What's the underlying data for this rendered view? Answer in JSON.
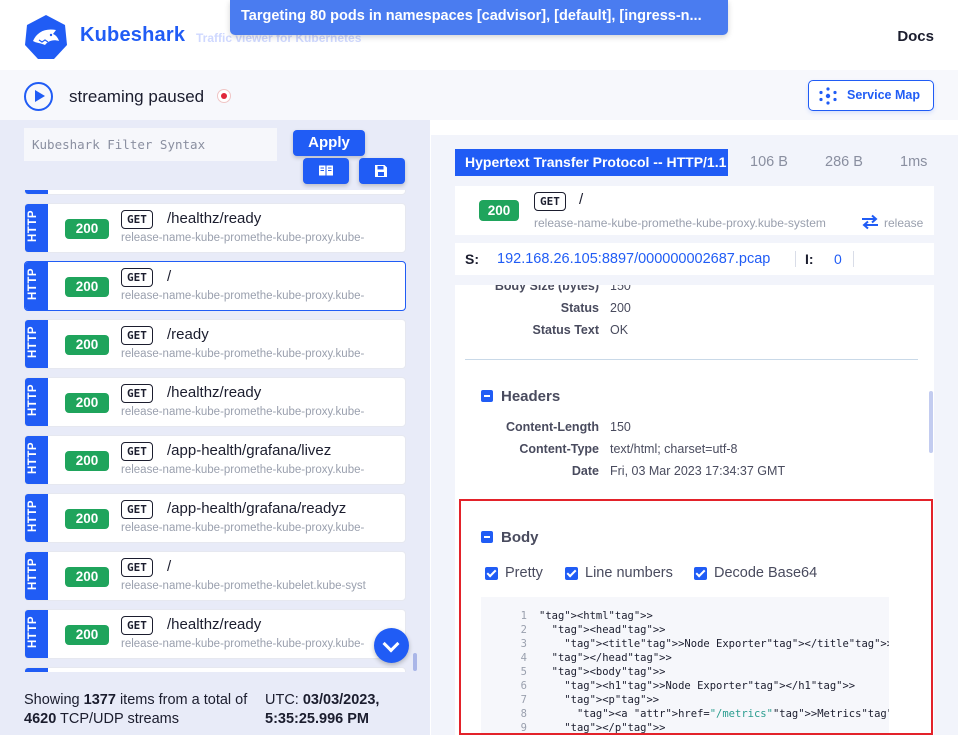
{
  "header": {
    "brand": "Kubeshark",
    "tagline": "Traffic viewer for Kubernetes",
    "docs_label": "Docs",
    "toast": "Targeting 80 pods in namespaces [cadvisor], [default], [ingress-n...",
    "logo_icon": "kubeshark-shark-logo-icon"
  },
  "statusbar": {
    "stream_status": "streaming paused",
    "service_map_label": "Service Map"
  },
  "left_panel": {
    "filter_placeholder": "Kubeshark Filter Syntax",
    "apply_label": "Apply",
    "rows": [
      {
        "protocol": "HTTP",
        "status": "200",
        "method": "GET",
        "path": "/healthz/ready",
        "source": "release-name-kube-promethe-kube-proxy.kube-"
      },
      {
        "protocol": "HTTP",
        "status": "200",
        "method": "GET",
        "path": "/",
        "source": "release-name-kube-promethe-kube-proxy.kube-"
      },
      {
        "protocol": "HTTP",
        "status": "200",
        "method": "GET",
        "path": "/ready",
        "source": "release-name-kube-promethe-kube-proxy.kube-"
      },
      {
        "protocol": "HTTP",
        "status": "200",
        "method": "GET",
        "path": "/healthz/ready",
        "source": "release-name-kube-promethe-kube-proxy.kube-"
      },
      {
        "protocol": "HTTP",
        "status": "200",
        "method": "GET",
        "path": "/app-health/grafana/livez",
        "source": "release-name-kube-promethe-kube-proxy.kube-"
      },
      {
        "protocol": "HTTP",
        "status": "200",
        "method": "GET",
        "path": "/app-health/grafana/readyz",
        "source": "release-name-kube-promethe-kube-proxy.kube-"
      },
      {
        "protocol": "HTTP",
        "status": "200",
        "method": "GET",
        "path": "/",
        "source": "release-name-kube-promethe-kubelet.kube-syst"
      },
      {
        "protocol": "HTTP",
        "status": "200",
        "method": "GET",
        "path": "/healthz/ready",
        "source": "release-name-kube-promethe-kube-proxy.kube-"
      }
    ],
    "footer": {
      "showing_prefix": "Showing ",
      "showing_count": "1377",
      "showing_mid": " items from a total of ",
      "total_count": "4620",
      "showing_suffix": " TCP/UDP streams",
      "utc_prefix": "UTC: ",
      "utc_value": "03/03/2023, 5:35:25.996 PM"
    }
  },
  "right_panel": {
    "protocol_banner": "Hypertext Transfer Protocol -- HTTP/1.1",
    "request_size": "106 B",
    "response_size": "286 B",
    "elapsed": "1ms",
    "entry": {
      "status": "200",
      "method": "GET",
      "path": "/",
      "source": "release-name-kube-promethe-kube-proxy.kube-system",
      "destination": "release"
    },
    "pcap": {
      "s_label": "S:",
      "file": "192.168.26.105:8897/000000002687.pcap",
      "i_label": "I:",
      "i_value": "0"
    },
    "response_fields": [
      {
        "key": "Body Size (bytes)",
        "value": "150"
      },
      {
        "key": "Status",
        "value": "200"
      },
      {
        "key": "Status Text",
        "value": "OK"
      }
    ],
    "headers_title": "Headers",
    "headers": [
      {
        "key": "Content-Length",
        "value": "150"
      },
      {
        "key": "Content-Type",
        "value": "text/html; charset=utf-8"
      },
      {
        "key": "Date",
        "value": "Fri, 03 Mar 2023 17:34:37 GMT"
      }
    ],
    "body_title": "Body",
    "checkboxes": [
      {
        "label": "Pretty",
        "checked": true
      },
      {
        "label": "Line numbers",
        "checked": true
      },
      {
        "label": "Decode Base64",
        "checked": true
      }
    ],
    "body_lines": [
      {
        "n": "1",
        "text": "<html>"
      },
      {
        "n": "2",
        "text": "  <head>"
      },
      {
        "n": "3",
        "text": "    <title>Node Exporter</title>"
      },
      {
        "n": "4",
        "text": "  </head>"
      },
      {
        "n": "5",
        "text": "  <body>"
      },
      {
        "n": "6",
        "text": "    <h1>Node Exporter</h1>"
      },
      {
        "n": "7",
        "text": "    <p>"
      },
      {
        "n": "8",
        "text": "      <a href=\"/metrics\">Metrics</a>"
      },
      {
        "n": "9",
        "text": "    </p>"
      }
    ]
  },
  "colors": {
    "accent": "#205cf5",
    "success": "#1fa45c",
    "highlight": "#e3222a"
  }
}
